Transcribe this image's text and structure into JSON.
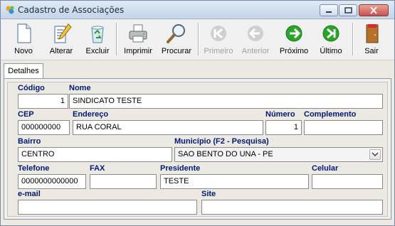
{
  "window": {
    "title": "Cadastro de Associações"
  },
  "toolbar": {
    "novo": "Novo",
    "alterar": "Alterar",
    "excluir": "Excluir",
    "imprimir": "Imprimir",
    "procurar": "Procurar",
    "primeiro": "Primeiro",
    "anterior": "Anterior",
    "proximo": "Próximo",
    "ultimo": "Último",
    "sair": "Sair",
    "disabled": [
      "Primeiro",
      "Anterior"
    ]
  },
  "tabs": {
    "detalhes": "Detalhes"
  },
  "form": {
    "codigo": {
      "label": "Código",
      "value": "1"
    },
    "nome": {
      "label": "Nome",
      "value": "SINDICATO TESTE"
    },
    "cep": {
      "label": "CEP",
      "value": "000000000"
    },
    "endereco": {
      "label": "Endereço",
      "value": "RUA CORAL"
    },
    "numero": {
      "label": "Número",
      "value": "1"
    },
    "complemento": {
      "label": "Complemento",
      "value": ""
    },
    "bairro": {
      "label": "Bairro",
      "value": "CENTRO"
    },
    "municipio": {
      "label": "Município (F2 - Pesquisa)",
      "value": "SAO BENTO DO UNA - PE"
    },
    "telefone": {
      "label": "Telefone",
      "value": "0000000000000"
    },
    "fax": {
      "label": "FAX",
      "value": ""
    },
    "presidente": {
      "label": "Presidente",
      "value": "TESTE"
    },
    "celular": {
      "label": "Celular",
      "value": ""
    },
    "email": {
      "label": "e-mail",
      "value": ""
    },
    "site": {
      "label": "Site",
      "value": ""
    }
  },
  "colors": {
    "label": "#00197a",
    "accent_green": "#2aa52a",
    "close_red": "#c75050"
  },
  "icons": [
    "app-icon",
    "new-document-icon",
    "edit-pencil-icon",
    "recycle-bin-icon",
    "printer-icon",
    "magnifier-icon",
    "first-arrow-icon",
    "previous-arrow-icon",
    "next-arrow-icon",
    "last-arrow-icon",
    "exit-door-icon",
    "chevron-down-icon"
  ]
}
